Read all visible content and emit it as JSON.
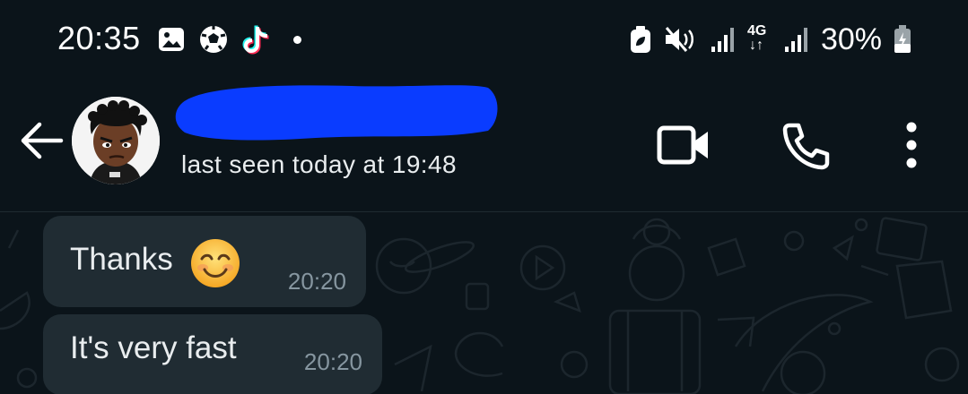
{
  "status_bar": {
    "time": "20:35",
    "left_icons": [
      "gallery-icon",
      "soccer-ball-icon",
      "tiktok-icon",
      "notification-dot"
    ],
    "right_icons": [
      "battery-saver-icon",
      "mute-icon",
      "signal-icon",
      "4g-data-icon",
      "signal-icon"
    ],
    "network_label": "4G",
    "battery_percent": "30%"
  },
  "header": {
    "contact_name": "",
    "last_seen": "last seen today at 19:48",
    "actions": [
      "video-call-icon",
      "voice-call-icon",
      "more-options-icon"
    ]
  },
  "messages": [
    {
      "text": "Thanks",
      "emoji": "smiling-face-emoji",
      "time": "20:20",
      "direction": "incoming"
    },
    {
      "text": "It's very fast",
      "time": "20:20",
      "direction": "incoming"
    }
  ],
  "colors": {
    "background": "#0b141a",
    "bubble": "#202c33",
    "text": "#e9edef",
    "time_text": "#8696a0",
    "redaction": "#0a3cff"
  }
}
